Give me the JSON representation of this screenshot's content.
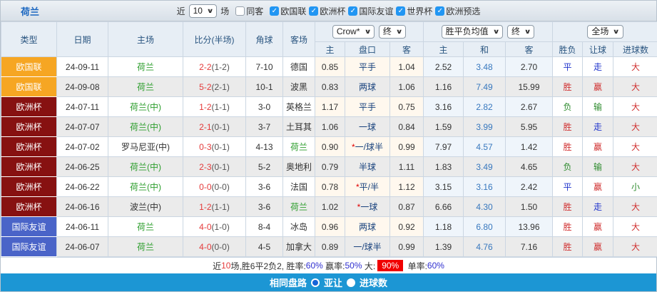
{
  "topbar": {
    "title": "荷兰",
    "recent_label": "近",
    "recent_select": "10",
    "matches_label": "场",
    "same_opponent": {
      "label": "同客",
      "checked": false
    },
    "competitions": [
      {
        "label": "欧国联",
        "checked": true
      },
      {
        "label": "欧洲杯",
        "checked": true
      },
      {
        "label": "国际友谊",
        "checked": true
      },
      {
        "label": "世界杯",
        "checked": true
      },
      {
        "label": "欧洲预选",
        "checked": true
      }
    ]
  },
  "header": {
    "columns": [
      "类型",
      "日期",
      "主场",
      "比分(半场)",
      "角球",
      "客场"
    ],
    "asian_group": {
      "selects": [
        "Crow*",
        "终"
      ],
      "sub": [
        "主",
        "盘口",
        "客"
      ]
    },
    "europe_group": {
      "selects": [
        "胜平负均值",
        "终"
      ],
      "sub": [
        "主",
        "和",
        "客"
      ]
    },
    "result_group": {
      "selects": [
        "全场"
      ],
      "sub": [
        "胜负",
        "让球",
        "进球数"
      ]
    }
  },
  "rows": [
    {
      "type": "欧国联",
      "date": "24-09-11",
      "home": "荷兰",
      "home_green": true,
      "score": "2-2",
      "half": "(1-2)",
      "corner": "7-10",
      "away": "德国",
      "away_green": false,
      "ah_home": "0.85",
      "handicap_star": false,
      "handicap": "平手",
      "ah_away": "1.04",
      "odds_home": "2.52",
      "odds_draw": "3.48",
      "odds_away": "2.70",
      "result": "平",
      "result_c": "blue",
      "let": "走",
      "let_c": "blue",
      "goals": "大",
      "goals_c": "red"
    },
    {
      "type": "欧国联",
      "date": "24-09-08",
      "home": "荷兰",
      "home_green": true,
      "score": "5-2",
      "half": "(2-1)",
      "corner": "10-1",
      "away": "波黑",
      "away_green": false,
      "ah_home": "0.83",
      "handicap_star": false,
      "handicap": "两球",
      "ah_away": "1.06",
      "odds_home": "1.16",
      "odds_draw": "7.49",
      "odds_away": "15.99",
      "result": "胜",
      "result_c": "red",
      "let": "赢",
      "let_c": "red",
      "goals": "大",
      "goals_c": "red"
    },
    {
      "type": "欧洲杯",
      "date": "24-07-11",
      "home": "荷兰(中)",
      "home_green": true,
      "score": "1-2",
      "half": "(1-1)",
      "corner": "3-0",
      "away": "英格兰",
      "away_green": false,
      "ah_home": "1.17",
      "handicap_star": false,
      "handicap": "平手",
      "ah_away": "0.75",
      "odds_home": "3.16",
      "odds_draw": "2.82",
      "odds_away": "2.67",
      "result": "负",
      "result_c": "green",
      "let": "输",
      "let_c": "green",
      "goals": "大",
      "goals_c": "red"
    },
    {
      "type": "欧洲杯",
      "date": "24-07-07",
      "home": "荷兰(中)",
      "home_green": true,
      "score": "2-1",
      "half": "(0-1)",
      "corner": "3-7",
      "away": "土耳其",
      "away_green": false,
      "ah_home": "1.06",
      "handicap_star": false,
      "handicap": "一球",
      "ah_away": "0.84",
      "odds_home": "1.59",
      "odds_draw": "3.99",
      "odds_away": "5.95",
      "result": "胜",
      "result_c": "red",
      "let": "走",
      "let_c": "blue",
      "goals": "大",
      "goals_c": "red"
    },
    {
      "type": "欧洲杯",
      "date": "24-07-02",
      "home": "罗马尼亚(中)",
      "home_green": false,
      "score": "0-3",
      "half": "(0-1)",
      "corner": "4-13",
      "away": "荷兰",
      "away_green": true,
      "ah_home": "0.90",
      "handicap_star": true,
      "handicap": "一/球半",
      "ah_away": "0.99",
      "odds_home": "7.97",
      "odds_draw": "4.57",
      "odds_away": "1.42",
      "result": "胜",
      "result_c": "red",
      "let": "赢",
      "let_c": "red",
      "goals": "大",
      "goals_c": "red"
    },
    {
      "type": "欧洲杯",
      "date": "24-06-25",
      "home": "荷兰(中)",
      "home_green": true,
      "score": "2-3",
      "half": "(0-1)",
      "corner": "5-2",
      "away": "奥地利",
      "away_green": false,
      "ah_home": "0.79",
      "handicap_star": false,
      "handicap": "半球",
      "ah_away": "1.11",
      "odds_home": "1.83",
      "odds_draw": "3.49",
      "odds_away": "4.65",
      "result": "负",
      "result_c": "green",
      "let": "输",
      "let_c": "green",
      "goals": "大",
      "goals_c": "red"
    },
    {
      "type": "欧洲杯",
      "date": "24-06-22",
      "home": "荷兰(中)",
      "home_green": true,
      "score": "0-0",
      "half": "(0-0)",
      "corner": "3-6",
      "away": "法国",
      "away_green": false,
      "ah_home": "0.78",
      "handicap_star": true,
      "handicap": "平/半",
      "ah_away": "1.12",
      "odds_home": "3.15",
      "odds_draw": "3.16",
      "odds_away": "2.42",
      "result": "平",
      "result_c": "blue",
      "let": "赢",
      "let_c": "red",
      "goals": "小",
      "goals_c": "green"
    },
    {
      "type": "欧洲杯",
      "date": "24-06-16",
      "home": "波兰(中)",
      "home_green": false,
      "score": "1-2",
      "half": "(1-1)",
      "corner": "3-6",
      "away": "荷兰",
      "away_green": true,
      "ah_home": "1.02",
      "handicap_star": true,
      "handicap": "一球",
      "ah_away": "0.87",
      "odds_home": "6.66",
      "odds_draw": "4.30",
      "odds_away": "1.50",
      "result": "胜",
      "result_c": "red",
      "let": "走",
      "let_c": "blue",
      "goals": "大",
      "goals_c": "red"
    },
    {
      "type": "国际友谊",
      "date": "24-06-11",
      "home": "荷兰",
      "home_green": true,
      "score": "4-0",
      "half": "(1-0)",
      "corner": "8-4",
      "away": "冰岛",
      "away_green": false,
      "ah_home": "0.96",
      "handicap_star": false,
      "handicap": "两球",
      "ah_away": "0.92",
      "odds_home": "1.18",
      "odds_draw": "6.80",
      "odds_away": "13.96",
      "result": "胜",
      "result_c": "red",
      "let": "赢",
      "let_c": "red",
      "goals": "大",
      "goals_c": "red"
    },
    {
      "type": "国际友谊",
      "date": "24-06-07",
      "home": "荷兰",
      "home_green": true,
      "score": "4-0",
      "half": "(0-0)",
      "corner": "4-5",
      "away": "加拿大",
      "away_green": false,
      "ah_home": "0.89",
      "handicap_star": false,
      "handicap": "一/球半",
      "ah_away": "0.99",
      "odds_home": "1.39",
      "odds_draw": "4.76",
      "odds_away": "7.16",
      "result": "胜",
      "result_c": "red",
      "let": "赢",
      "let_c": "red",
      "goals": "大",
      "goals_c": "red"
    }
  ],
  "summary": {
    "parts": [
      {
        "t": "近",
        "c": "dark"
      },
      {
        "t": "10",
        "c": "red"
      },
      {
        "t": "场,胜6平2负2, 胜率:",
        "c": "dark"
      },
      {
        "t": "60%",
        "c": "blue"
      },
      {
        "t": " 赢率:",
        "c": "dark"
      },
      {
        "t": "50%",
        "c": "blue"
      },
      {
        "t": " 大:",
        "c": "dark"
      },
      {
        "t": "90%",
        "c": "badge"
      },
      {
        "t": " 单率:",
        "c": "dark"
      },
      {
        "t": "60%",
        "c": "blue"
      }
    ]
  },
  "footer": {
    "label": "相同盘路",
    "options": [
      {
        "label": "亚让",
        "selected": true
      },
      {
        "label": "进球数",
        "selected": false
      }
    ]
  },
  "colors": {
    "title_blue": "#1A66C0",
    "footer_bar": "#1C96D4",
    "type_colors": {
      "欧国联": "#F6A623",
      "欧洲杯": "#871111",
      "国际友谊": "#4A64C8"
    }
  }
}
